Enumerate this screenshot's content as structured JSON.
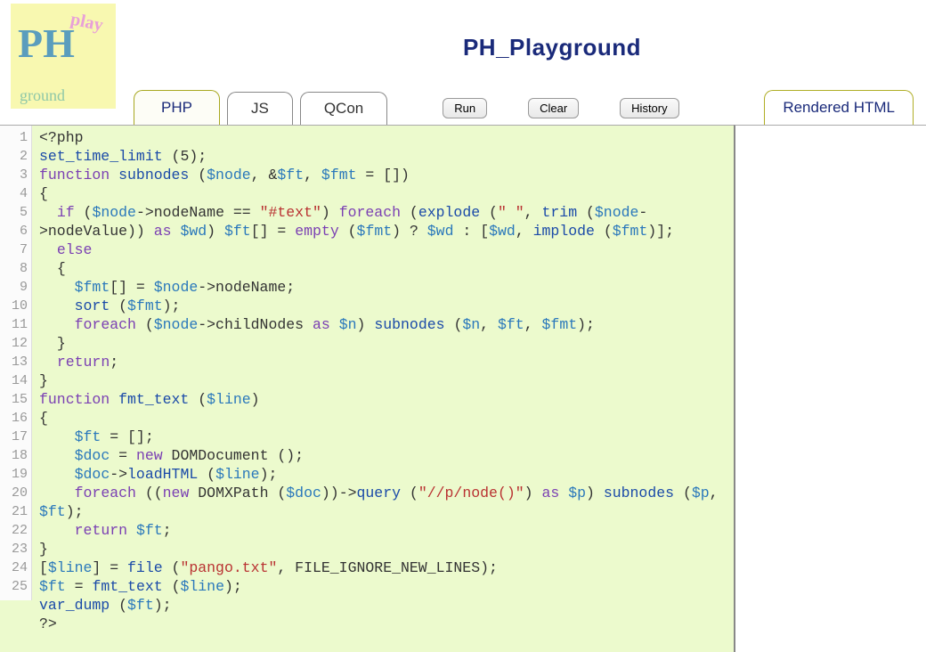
{
  "header": {
    "title": "PH_Playground",
    "logo": {
      "t1": "PH",
      "t2": "play",
      "t3": "ground"
    }
  },
  "tabs": {
    "items": [
      {
        "label": "PHP",
        "active": true
      },
      {
        "label": "JS",
        "active": false
      },
      {
        "label": "QCon",
        "active": false
      }
    ],
    "rendered": "Rendered HTML"
  },
  "buttons": {
    "run": "Run",
    "clear": "Clear",
    "history": "History"
  },
  "code": {
    "lines": [
      "1",
      "2",
      "3",
      "4",
      "5",
      "6",
      "7",
      "8",
      "9",
      "10",
      "11",
      "12",
      "13",
      "14",
      "15",
      "16",
      "17",
      "18",
      "19",
      "20",
      "21",
      "22",
      "23",
      "24",
      "25"
    ],
    "tokens": [
      [
        {
          "t": "<?php",
          "c": "pl"
        }
      ],
      [
        {
          "t": "set_time_limit ",
          "c": "fn"
        },
        {
          "t": "(",
          "c": "op"
        },
        {
          "t": "5",
          "c": "pl"
        },
        {
          "t": ");",
          "c": "op"
        }
      ],
      [
        {
          "t": "function",
          "c": "kw"
        },
        {
          "t": " ",
          "c": "pl"
        },
        {
          "t": "subnodes",
          "c": "fn"
        },
        {
          "t": " (",
          "c": "op"
        },
        {
          "t": "$node",
          "c": "var"
        },
        {
          "t": ", &",
          "c": "op"
        },
        {
          "t": "$ft",
          "c": "var"
        },
        {
          "t": ", ",
          "c": "op"
        },
        {
          "t": "$fmt",
          "c": "var"
        },
        {
          "t": " = [])",
          "c": "op"
        }
      ],
      [
        {
          "t": "{",
          "c": "op"
        }
      ],
      [
        {
          "t": "  ",
          "c": "pl"
        },
        {
          "t": "if",
          "c": "kw"
        },
        {
          "t": " (",
          "c": "op"
        },
        {
          "t": "$node",
          "c": "var"
        },
        {
          "t": "->nodeName == ",
          "c": "op"
        },
        {
          "t": "\"#text\"",
          "c": "str"
        },
        {
          "t": ") ",
          "c": "op"
        },
        {
          "t": "foreach",
          "c": "kw"
        },
        {
          "t": " (",
          "c": "op"
        },
        {
          "t": "explode",
          "c": "fn"
        },
        {
          "t": " (",
          "c": "op"
        },
        {
          "t": "\" \"",
          "c": "str"
        },
        {
          "t": ", ",
          "c": "op"
        },
        {
          "t": "trim",
          "c": "fn"
        },
        {
          "t": " (",
          "c": "op"
        },
        {
          "t": "$node",
          "c": "var"
        },
        {
          "t": "->nodeValue)) ",
          "c": "op"
        },
        {
          "t": "as",
          "c": "kw"
        },
        {
          "t": " ",
          "c": "pl"
        },
        {
          "t": "$wd",
          "c": "var"
        },
        {
          "t": ") ",
          "c": "op"
        },
        {
          "t": "$ft",
          "c": "var"
        },
        {
          "t": "[] = ",
          "c": "op"
        },
        {
          "t": "empty",
          "c": "kw"
        },
        {
          "t": " (",
          "c": "op"
        },
        {
          "t": "$fmt",
          "c": "var"
        },
        {
          "t": ") ? ",
          "c": "op"
        },
        {
          "t": "$wd",
          "c": "var"
        },
        {
          "t": " : [",
          "c": "op"
        },
        {
          "t": "$wd",
          "c": "var"
        },
        {
          "t": ", ",
          "c": "op"
        },
        {
          "t": "implode",
          "c": "fn"
        },
        {
          "t": " (",
          "c": "op"
        },
        {
          "t": "$fmt",
          "c": "var"
        },
        {
          "t": ")];",
          "c": "op"
        }
      ],
      [
        {
          "t": "  ",
          "c": "pl"
        },
        {
          "t": "else",
          "c": "kw"
        }
      ],
      [
        {
          "t": "  {",
          "c": "op"
        }
      ],
      [
        {
          "t": "    ",
          "c": "pl"
        },
        {
          "t": "$fmt",
          "c": "var"
        },
        {
          "t": "[] = ",
          "c": "op"
        },
        {
          "t": "$node",
          "c": "var"
        },
        {
          "t": "->nodeName;",
          "c": "op"
        }
      ],
      [
        {
          "t": "    ",
          "c": "pl"
        },
        {
          "t": "sort",
          "c": "fn"
        },
        {
          "t": " (",
          "c": "op"
        },
        {
          "t": "$fmt",
          "c": "var"
        },
        {
          "t": ");",
          "c": "op"
        }
      ],
      [
        {
          "t": "    ",
          "c": "pl"
        },
        {
          "t": "foreach",
          "c": "kw"
        },
        {
          "t": " (",
          "c": "op"
        },
        {
          "t": "$node",
          "c": "var"
        },
        {
          "t": "->childNodes ",
          "c": "op"
        },
        {
          "t": "as",
          "c": "kw"
        },
        {
          "t": " ",
          "c": "pl"
        },
        {
          "t": "$n",
          "c": "var"
        },
        {
          "t": ") ",
          "c": "op"
        },
        {
          "t": "subnodes ",
          "c": "fn"
        },
        {
          "t": "(",
          "c": "op"
        },
        {
          "t": "$n",
          "c": "var"
        },
        {
          "t": ", ",
          "c": "op"
        },
        {
          "t": "$ft",
          "c": "var"
        },
        {
          "t": ", ",
          "c": "op"
        },
        {
          "t": "$fmt",
          "c": "var"
        },
        {
          "t": ");",
          "c": "op"
        }
      ],
      [
        {
          "t": "  }",
          "c": "op"
        }
      ],
      [
        {
          "t": "  ",
          "c": "pl"
        },
        {
          "t": "return",
          "c": "kw"
        },
        {
          "t": ";",
          "c": "op"
        }
      ],
      [
        {
          "t": "}",
          "c": "op"
        }
      ],
      [
        {
          "t": "function",
          "c": "kw"
        },
        {
          "t": " ",
          "c": "pl"
        },
        {
          "t": "fmt_text",
          "c": "fn"
        },
        {
          "t": " (",
          "c": "op"
        },
        {
          "t": "$line",
          "c": "var"
        },
        {
          "t": ")",
          "c": "op"
        }
      ],
      [
        {
          "t": "{",
          "c": "op"
        }
      ],
      [
        {
          "t": "    ",
          "c": "pl"
        },
        {
          "t": "$ft",
          "c": "var"
        },
        {
          "t": " = [];",
          "c": "op"
        }
      ],
      [
        {
          "t": "    ",
          "c": "pl"
        },
        {
          "t": "$doc",
          "c": "var"
        },
        {
          "t": " = ",
          "c": "op"
        },
        {
          "t": "new",
          "c": "kw"
        },
        {
          "t": " DOMDocument ();",
          "c": "op"
        }
      ],
      [
        {
          "t": "    ",
          "c": "pl"
        },
        {
          "t": "$doc",
          "c": "var"
        },
        {
          "t": "->",
          "c": "op"
        },
        {
          "t": "loadHTML ",
          "c": "fn"
        },
        {
          "t": "(",
          "c": "op"
        },
        {
          "t": "$line",
          "c": "var"
        },
        {
          "t": ");",
          "c": "op"
        }
      ],
      [
        {
          "t": "    ",
          "c": "pl"
        },
        {
          "t": "foreach",
          "c": "kw"
        },
        {
          "t": " ((",
          "c": "op"
        },
        {
          "t": "new",
          "c": "kw"
        },
        {
          "t": " DOMXPath (",
          "c": "op"
        },
        {
          "t": "$doc",
          "c": "var"
        },
        {
          "t": "))->",
          "c": "op"
        },
        {
          "t": "query ",
          "c": "fn"
        },
        {
          "t": "(",
          "c": "op"
        },
        {
          "t": "\"//p/node()\"",
          "c": "str"
        },
        {
          "t": ") ",
          "c": "op"
        },
        {
          "t": "as",
          "c": "kw"
        },
        {
          "t": " ",
          "c": "pl"
        },
        {
          "t": "$p",
          "c": "var"
        },
        {
          "t": ") ",
          "c": "op"
        },
        {
          "t": "subnodes ",
          "c": "fn"
        },
        {
          "t": "(",
          "c": "op"
        },
        {
          "t": "$p",
          "c": "var"
        },
        {
          "t": ", ",
          "c": "op"
        },
        {
          "t": "$ft",
          "c": "var"
        },
        {
          "t": ");",
          "c": "op"
        }
      ],
      [
        {
          "t": "    ",
          "c": "pl"
        },
        {
          "t": "return",
          "c": "kw"
        },
        {
          "t": " ",
          "c": "pl"
        },
        {
          "t": "$ft",
          "c": "var"
        },
        {
          "t": ";",
          "c": "op"
        }
      ],
      [
        {
          "t": "}",
          "c": "op"
        }
      ],
      [
        {
          "t": "[",
          "c": "op"
        },
        {
          "t": "$line",
          "c": "var"
        },
        {
          "t": "] = ",
          "c": "op"
        },
        {
          "t": "file ",
          "c": "fn"
        },
        {
          "t": "(",
          "c": "op"
        },
        {
          "t": "\"pango.txt\"",
          "c": "str"
        },
        {
          "t": ", FILE_IGNORE_NEW_LINES);",
          "c": "op"
        }
      ],
      [
        {
          "t": "$ft",
          "c": "var"
        },
        {
          "t": " = ",
          "c": "op"
        },
        {
          "t": "fmt_text ",
          "c": "fn"
        },
        {
          "t": "(",
          "c": "op"
        },
        {
          "t": "$line",
          "c": "var"
        },
        {
          "t": ");",
          "c": "op"
        }
      ],
      [
        {
          "t": "var_dump ",
          "c": "fn"
        },
        {
          "t": "(",
          "c": "op"
        },
        {
          "t": "$ft",
          "c": "var"
        },
        {
          "t": ");",
          "c": "op"
        }
      ],
      [
        {
          "t": "?>",
          "c": "pl"
        }
      ]
    ]
  }
}
